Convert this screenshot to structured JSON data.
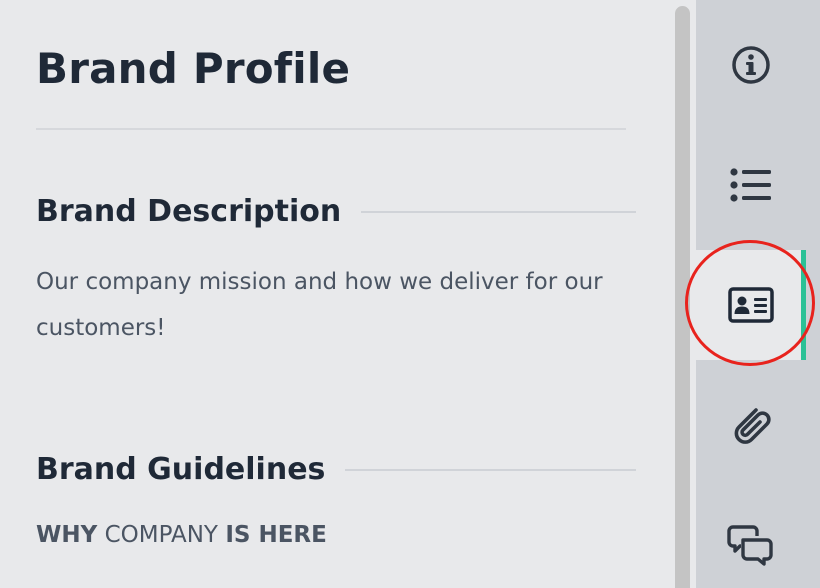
{
  "page": {
    "title": "Brand Profile"
  },
  "sections": {
    "description": {
      "heading": "Brand Description",
      "body": "Our company mission and how we deliver for our customers!"
    },
    "guidelines": {
      "heading": "Brand Guidelines",
      "line": {
        "part1": "WHY",
        "part2": " COMPANY ",
        "part3": "IS HERE"
      }
    }
  },
  "rail": {
    "items": [
      {
        "icon": "info-icon",
        "active": false
      },
      {
        "icon": "list-icon",
        "active": false
      },
      {
        "icon": "id-card-icon",
        "active": true
      },
      {
        "icon": "paperclip-icon",
        "active": false
      },
      {
        "icon": "chat-icon",
        "active": false
      }
    ]
  },
  "colors": {
    "background": "#e8e9eb",
    "rail": "#ced1d6",
    "accent": "#2bc196",
    "highlight": "#e8231d",
    "text_dark": "#1f2937",
    "text_body": "#4b5563"
  }
}
